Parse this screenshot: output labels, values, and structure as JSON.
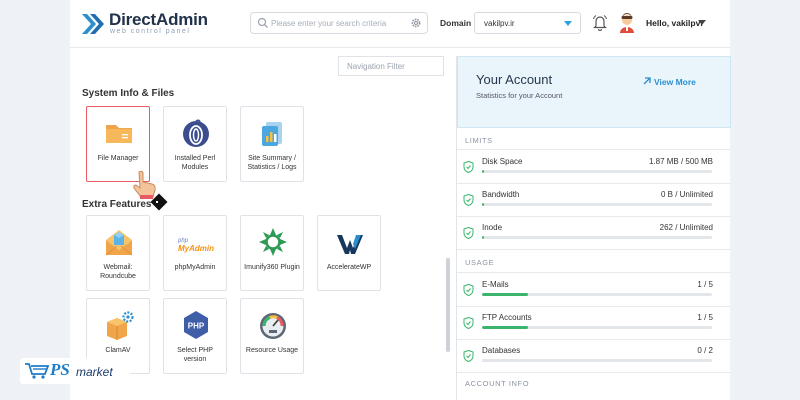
{
  "header": {
    "brand_title": "DirectAdmin",
    "brand_subtitle": "web control panel",
    "search_placeholder": "Please enter your search criteria",
    "domain_label": "Domain",
    "domain_value": "vakilpv.ir",
    "greeting": "Hello, vakilpvi"
  },
  "nav_filter_placeholder": "Navigation Filter",
  "sections": {
    "system": {
      "title": "System Info & Files",
      "tiles": [
        {
          "label": "File Manager",
          "icon": "folder-icon"
        },
        {
          "label": "Installed Perl Modules",
          "icon": "perl-onion-icon"
        },
        {
          "label": "Site Summary / Statistics / Logs",
          "icon": "statistics-icon"
        }
      ]
    },
    "extra": {
      "title": "Extra Features",
      "tiles": [
        {
          "label": "Webmail: Roundcube",
          "icon": "roundcube-icon"
        },
        {
          "label": "phpMyAdmin",
          "icon": "phpmyadmin-icon"
        },
        {
          "label": "Imunify360 Plugin",
          "icon": "imunify-icon"
        },
        {
          "label": "AccelerateWP",
          "icon": "acceleratewp-icon"
        },
        {
          "label": "ClamAV",
          "icon": "clamav-box-icon"
        },
        {
          "label": "Select PHP version",
          "icon": "php-icon"
        },
        {
          "label": "Resource Usage",
          "icon": "gauge-icon"
        }
      ],
      "phpmyadmin_logo_small": "php",
      "phpmyadmin_logo_big": "MyAdmin"
    }
  },
  "account": {
    "title": "Your Account",
    "subtitle": "Statistics for your Account",
    "view_more": "View More"
  },
  "limits": {
    "label": "LIMITS",
    "items": [
      {
        "name": "Disk Space",
        "value": "1.87 MB / 500 MB",
        "percent": 1
      },
      {
        "name": "Bandwidth",
        "value": "0 B / Unlimited",
        "percent": 1
      },
      {
        "name": "Inode",
        "value": "262 / Unlimited",
        "percent": 1
      }
    ]
  },
  "usage": {
    "label": "USAGE",
    "items": [
      {
        "name": "E-Mails",
        "value": "1 / 5",
        "percent": 20
      },
      {
        "name": "FTP Accounts",
        "value": "1 / 5",
        "percent": 20
      },
      {
        "name": "Databases",
        "value": "0 / 2",
        "percent": 0
      }
    ]
  },
  "account_info_label": "ACCOUNT INFO",
  "watermark": {
    "ps": "PS",
    "market": "market"
  },
  "colors": {
    "accent": "#2a8fd0",
    "active_tile_border": "#e85b62",
    "progress": "#3bb46e"
  }
}
